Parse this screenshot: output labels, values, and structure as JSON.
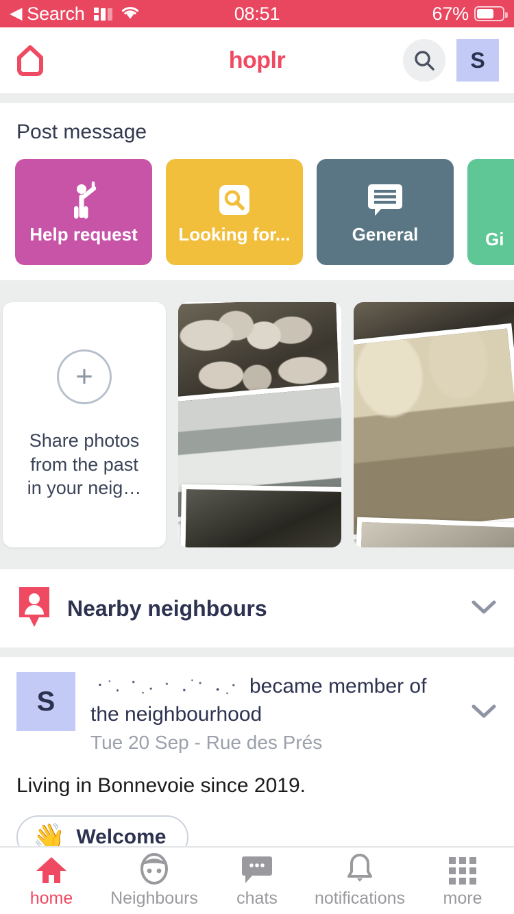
{
  "statusbar": {
    "back_label": "◀",
    "carrier": "Search",
    "time": "08:51",
    "battery_percent": "67%",
    "signal_icon": "signal-bars-icon",
    "wifi_icon": "wifi-icon",
    "battery_icon": "battery-icon"
  },
  "header": {
    "brand": "hoplr",
    "home_icon": "house-outline-icon",
    "search_icon": "search-icon",
    "avatar_initial": "S"
  },
  "post_message": {
    "title": "Post message",
    "categories": [
      {
        "label": "Help request",
        "color": "#c854a8",
        "icon": "person-raising-hand-icon"
      },
      {
        "label": "Looking for...",
        "color": "#f2bf3c",
        "icon": "magnifier-square-icon"
      },
      {
        "label": "General",
        "color": "#5a7684",
        "icon": "speech-bubble-lines-icon"
      },
      {
        "label": "Gi",
        "color": "#5fc795",
        "icon": "gift-icon"
      }
    ]
  },
  "photos": {
    "add_card": {
      "plus_icon": "plus-circle-icon",
      "text": "Share photos from the past in your neig…"
    },
    "items": [
      {
        "name": "vintage-group-photo-collage",
        "tone": "black-and-white"
      },
      {
        "name": "vintage-village-photo-collage",
        "tone": "sepia"
      }
    ]
  },
  "nearby": {
    "title": "Nearby neighbours",
    "pin_icon": "map-pin-person-icon",
    "chevron_icon": "chevron-down-icon"
  },
  "feed_post": {
    "avatar_initial": "S",
    "author_name_redacted": true,
    "headline_rest": "became member of the neighbourhood",
    "meta": "Tue 20 Sep - Rue des Prés",
    "body": "Living in Bonnevoie since 2019.",
    "reaction": {
      "emoji": "👋",
      "label": "Welcome"
    },
    "chevron_icon": "chevron-down-icon"
  },
  "tabbar": {
    "items": [
      {
        "label": "home",
        "icon": "home-icon",
        "active": true
      },
      {
        "label": "Neighbours",
        "icon": "face-icon",
        "active": false
      },
      {
        "label": "chats",
        "icon": "chat-bubble-icon",
        "active": false
      },
      {
        "label": "notifications",
        "icon": "bell-icon",
        "active": false
      },
      {
        "label": "more",
        "icon": "grid-dots-icon",
        "active": false
      }
    ]
  },
  "colors": {
    "brand_red": "#ef4a62",
    "statusbar_red": "#e8475f",
    "avatar_lavender": "#c3caf5",
    "page_bg": "#eceded",
    "text_dark": "#2d3250"
  }
}
